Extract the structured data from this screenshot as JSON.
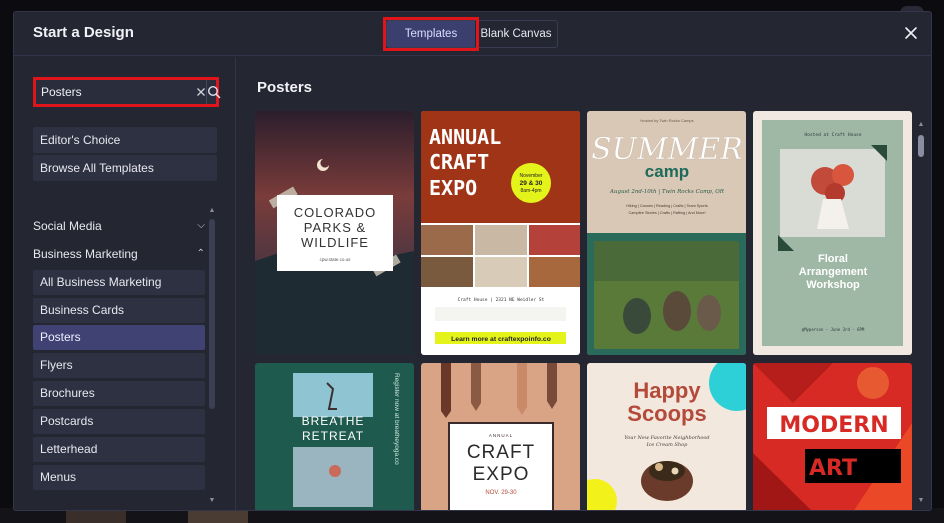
{
  "modal": {
    "title": "Start a Design",
    "tabs": [
      {
        "label": "Templates",
        "active": true
      },
      {
        "label": "Blank Canvas",
        "active": false
      }
    ]
  },
  "search": {
    "value": "Posters",
    "placeholder": ""
  },
  "sidebar": {
    "quick_links": [
      "Editor's Choice",
      "Browse All Templates"
    ],
    "categories": [
      {
        "label": "Social Media",
        "expanded": false
      },
      {
        "label": "Business Marketing",
        "expanded": true
      }
    ],
    "sub_items": [
      "All Business Marketing",
      "Business Cards",
      "Posters",
      "Flyers",
      "Brochures",
      "Postcards",
      "Letterhead",
      "Menus"
    ],
    "selected": "Posters"
  },
  "content": {
    "title": "Posters",
    "templates": [
      {
        "name": "colorado",
        "lines": [
          "COLORADO",
          "PARKS &",
          "WILDLIFE",
          "cpw.state.co.us"
        ]
      },
      {
        "name": "craft-expo",
        "lines": [
          "ANNUAL",
          "CRAFT",
          "EXPO",
          "November",
          "29 & 30",
          "8am-4pm",
          "Craft House | 2321 NE Weidler St",
          "Learn more at craftexpoinfo.co"
        ]
      },
      {
        "name": "summer-camp",
        "lines": [
          "Hosted by Twin Rocks Camps",
          "SUMMER",
          "camp",
          "August 2nd-10th | Twin Rocks Camp, OR",
          "Hiking | Canoes | Reading | Crafts | Team Sports",
          "Campfire Stories | Crafts | Rafting | And More!"
        ]
      },
      {
        "name": "floral",
        "lines": [
          "Hosted at Craft House",
          "Floral",
          "Arrangement",
          "Workshop",
          "@Myperson - June 3rd - 6PM"
        ]
      },
      {
        "name": "breathe",
        "lines": [
          "BREATHE",
          "RETREAT",
          "Register now at breatheyoga.co"
        ]
      },
      {
        "name": "craft-expo-2",
        "lines": [
          "ANNUAL",
          "CRAFT",
          "EXPO",
          "NOV. 29-30"
        ]
      },
      {
        "name": "happy-scoops",
        "lines": [
          "Happy",
          "Scoops",
          "Your New Favorite Neighborhood",
          "Ice Cream Shop"
        ]
      },
      {
        "name": "modern-art",
        "lines": [
          "MODERN",
          "ART"
        ]
      }
    ]
  },
  "colors": {
    "accent": "#3f4272",
    "highlight": "#e0141b",
    "panel": "#242632"
  }
}
